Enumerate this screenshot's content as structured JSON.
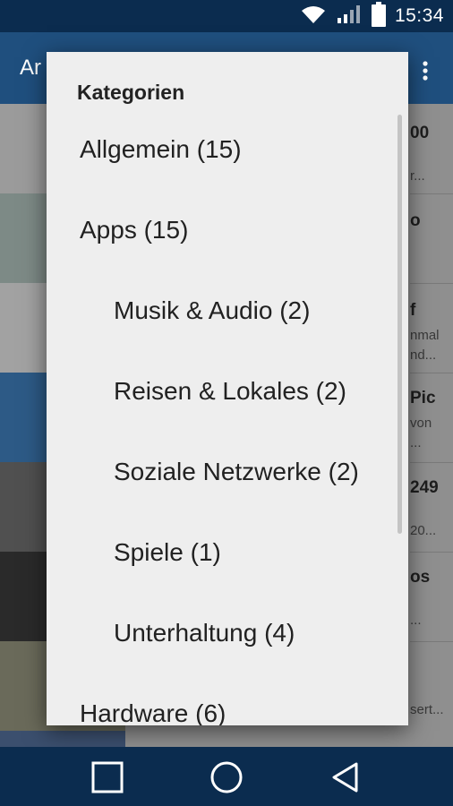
{
  "status_bar": {
    "time": "15:34",
    "wifi_icon": "wifi-icon",
    "signal_icon": "signal-icon",
    "battery_icon": "battery-icon"
  },
  "app_bar": {
    "title_fragment": "Ar",
    "menu_icon": "overflow-menu-icon"
  },
  "background_peek": [
    {
      "text": "00",
      "sub": "r..."
    },
    {
      "text": "o",
      "sub": ""
    },
    {
      "text": "f",
      "sub": "nmal\nnd..."
    },
    {
      "text": "Pic",
      "sub": "von\n..."
    },
    {
      "text": "249",
      "sub": "20..."
    },
    {
      "text": "os",
      "sub": "..."
    },
    {
      "text": "",
      "sub": "sert..."
    }
  ],
  "dialog": {
    "title": "Kategorien",
    "categories": [
      {
        "label": "Allgemein (15)",
        "level": "top"
      },
      {
        "label": "Apps (15)",
        "level": "top"
      },
      {
        "label": "Musik & Audio (2)",
        "level": "sub"
      },
      {
        "label": "Reisen & Lokales (2)",
        "level": "sub"
      },
      {
        "label": "Soziale Netzwerke (2)",
        "level": "sub"
      },
      {
        "label": "Spiele (1)",
        "level": "sub"
      },
      {
        "label": "Unterhaltung (4)",
        "level": "sub"
      },
      {
        "label": "Hardware (6)",
        "level": "top"
      }
    ]
  },
  "nav_bar": {
    "recents_icon": "recents-square-icon",
    "home_icon": "home-circle-icon",
    "back_icon": "back-triangle-icon"
  },
  "colors": {
    "status_bar": "#0b2c4f",
    "app_bar": "#1f4f7e",
    "dialog_bg": "#eeeeee",
    "text": "#212121"
  }
}
